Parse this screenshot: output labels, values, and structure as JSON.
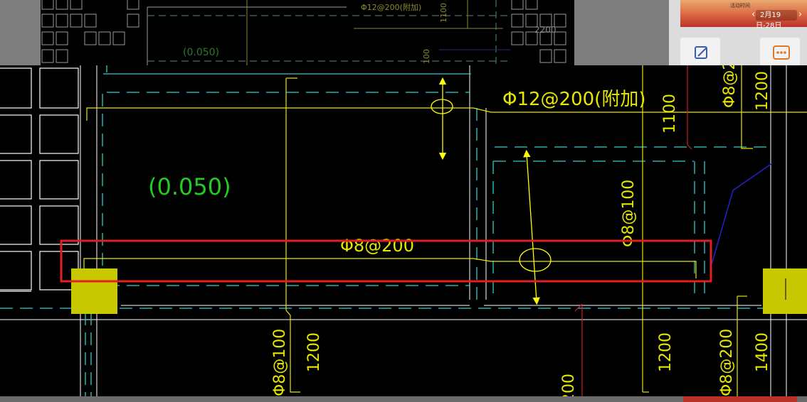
{
  "background_drawing": {
    "level_label": "(0.050)",
    "rebar_label": "Φ12@200(附加)",
    "dim_1100": "1100",
    "dim_2200": "2200",
    "dim_100": "100"
  },
  "right_panel": {
    "banner_title": "活动时间",
    "banner_date": "2月19日-28日",
    "tile_icons": [
      "edit-icon",
      "more-icon"
    ]
  },
  "drawing": {
    "level_label": "(0.050)",
    "rebar_top": "Φ12@200(附加)",
    "rebar_mid": "Φ8@200",
    "rebar_right_vertical": "Φ8@100",
    "dim_top_right_1100": "1100",
    "dim_top_far_rebar": "Φ8@2",
    "dim_top_far_1200": "1200",
    "dim_bottom_rebar_left": "Φ8@100",
    "dim_bottom_1200_left": "1200",
    "dim_bottom_partial": "200",
    "dim_bottom_1200_right": "1200",
    "dim_bottom_rebar_right": "Φ8@200",
    "dim_bottom_1400": "1400"
  },
  "colors": {
    "canvas": "#000000",
    "wall": "#ffffff",
    "axis_dashed": "#33cccc",
    "rebar": "#e6e600",
    "level_text": "#22cc22",
    "highlight_box": "#e02020",
    "column_fill": "#c8c800",
    "stair_line": "#2222cc"
  }
}
